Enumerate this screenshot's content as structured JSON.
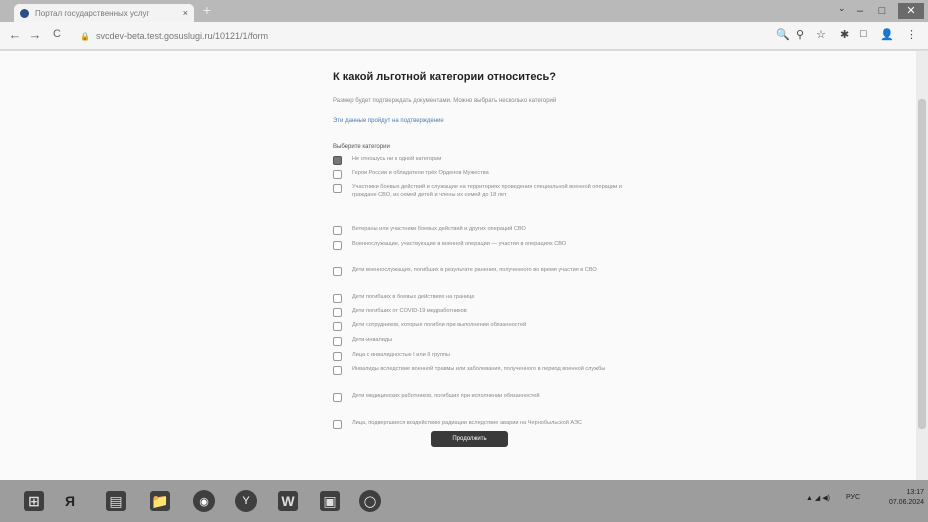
{
  "browser": {
    "tab_title": "Портал государственных услуг",
    "tab_close": "×",
    "new_tab": "+",
    "tab_dropdown": "⌄",
    "window_controls": [
      "–",
      "□",
      "✕"
    ],
    "back": "←",
    "forward": "→",
    "reload": "C",
    "url": "svcdev-beta.test.gosuslugi.ru/10121/1/form",
    "toolbar_icons": [
      "🔍",
      "⚲",
      "☆",
      "✱",
      "□",
      "👤",
      "⋮"
    ]
  },
  "page": {
    "title": "К какой льготной категории относитесь?",
    "subtitle": "Размер будет подтверждать документами. Можно выбрать несколько категорий",
    "link": "Эти данные пройдут на подтверждение",
    "group_label": "Выберите категории",
    "categories": [
      {
        "label": "Не отношусь ни к одной категории",
        "checked": true
      },
      {
        "label": "Герои России и обладатели трёх Орденов Мужества",
        "checked": false
      },
      {
        "label": "Участники боевых действий и служащие на территориях проведения специальной военной операции и граждане СВО, из семей детей и члены их семей до 18 лет",
        "checked": false
      },
      {
        "label": "Ветераны или участники боевых действий и других операций СВО",
        "checked": false
      },
      {
        "label": "Военнослужащие, участвующие в военной операции — участия в операциях СВО",
        "checked": false
      },
      {
        "label": "Дети военнослужащих, погибших в результате ранения, полученного во время участия в СВО",
        "checked": false
      },
      {
        "label": "Дети погибших в боевых действиях на границе",
        "checked": false
      },
      {
        "label": "Дети погибших от COVID-19 медработников",
        "checked": false
      },
      {
        "label": "Дети сотрудников, которые погибли при выполнении обязанностей",
        "checked": false
      },
      {
        "label": "Дети-инвалиды",
        "checked": false
      },
      {
        "label": "Лица с инвалидностью I или II группы",
        "checked": false
      },
      {
        "label": "Инвалиды вследствие военной травмы или заболевания, полученного в период военной службы",
        "checked": false
      },
      {
        "label": "Дети медицинских работников, погибших при исполнении обязанностей",
        "checked": false
      },
      {
        "label": "Лица, подвергшиеся воздействию радиации вследствие аварии на Чернобыльской АЭС",
        "checked": false
      }
    ],
    "next_button": "Продолжить"
  },
  "taskbar": {
    "apps": [
      "⊞",
      "Я",
      "▤",
      "📁",
      "◉",
      "Y",
      "W",
      "▣",
      "◯"
    ],
    "tray": "▲ ◢ ◀)",
    "lang": "РУС",
    "time": "13:17",
    "date": "07.06.2024"
  }
}
